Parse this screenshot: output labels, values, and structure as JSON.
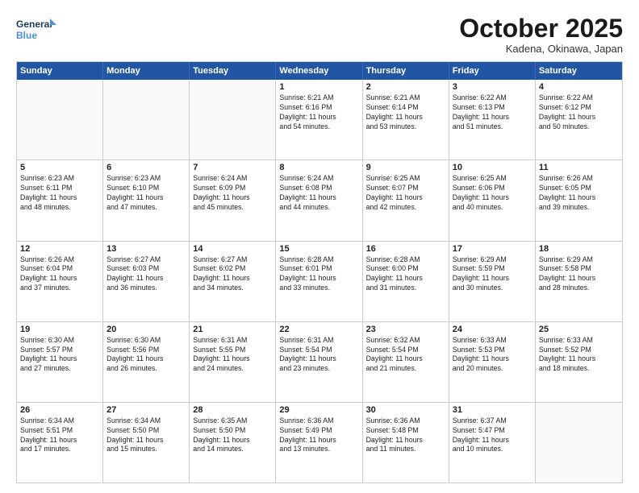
{
  "header": {
    "logo_line1": "General",
    "logo_line2": "Blue",
    "month": "October 2025",
    "location": "Kadena, Okinawa, Japan"
  },
  "weekdays": [
    "Sunday",
    "Monday",
    "Tuesday",
    "Wednesday",
    "Thursday",
    "Friday",
    "Saturday"
  ],
  "weeks": [
    [
      {
        "day": "",
        "info": ""
      },
      {
        "day": "",
        "info": ""
      },
      {
        "day": "",
        "info": ""
      },
      {
        "day": "1",
        "info": "Sunrise: 6:21 AM\nSunset: 6:16 PM\nDaylight: 11 hours\nand 54 minutes."
      },
      {
        "day": "2",
        "info": "Sunrise: 6:21 AM\nSunset: 6:14 PM\nDaylight: 11 hours\nand 53 minutes."
      },
      {
        "day": "3",
        "info": "Sunrise: 6:22 AM\nSunset: 6:13 PM\nDaylight: 11 hours\nand 51 minutes."
      },
      {
        "day": "4",
        "info": "Sunrise: 6:22 AM\nSunset: 6:12 PM\nDaylight: 11 hours\nand 50 minutes."
      }
    ],
    [
      {
        "day": "5",
        "info": "Sunrise: 6:23 AM\nSunset: 6:11 PM\nDaylight: 11 hours\nand 48 minutes."
      },
      {
        "day": "6",
        "info": "Sunrise: 6:23 AM\nSunset: 6:10 PM\nDaylight: 11 hours\nand 47 minutes."
      },
      {
        "day": "7",
        "info": "Sunrise: 6:24 AM\nSunset: 6:09 PM\nDaylight: 11 hours\nand 45 minutes."
      },
      {
        "day": "8",
        "info": "Sunrise: 6:24 AM\nSunset: 6:08 PM\nDaylight: 11 hours\nand 44 minutes."
      },
      {
        "day": "9",
        "info": "Sunrise: 6:25 AM\nSunset: 6:07 PM\nDaylight: 11 hours\nand 42 minutes."
      },
      {
        "day": "10",
        "info": "Sunrise: 6:25 AM\nSunset: 6:06 PM\nDaylight: 11 hours\nand 40 minutes."
      },
      {
        "day": "11",
        "info": "Sunrise: 6:26 AM\nSunset: 6:05 PM\nDaylight: 11 hours\nand 39 minutes."
      }
    ],
    [
      {
        "day": "12",
        "info": "Sunrise: 6:26 AM\nSunset: 6:04 PM\nDaylight: 11 hours\nand 37 minutes."
      },
      {
        "day": "13",
        "info": "Sunrise: 6:27 AM\nSunset: 6:03 PM\nDaylight: 11 hours\nand 36 minutes."
      },
      {
        "day": "14",
        "info": "Sunrise: 6:27 AM\nSunset: 6:02 PM\nDaylight: 11 hours\nand 34 minutes."
      },
      {
        "day": "15",
        "info": "Sunrise: 6:28 AM\nSunset: 6:01 PM\nDaylight: 11 hours\nand 33 minutes."
      },
      {
        "day": "16",
        "info": "Sunrise: 6:28 AM\nSunset: 6:00 PM\nDaylight: 11 hours\nand 31 minutes."
      },
      {
        "day": "17",
        "info": "Sunrise: 6:29 AM\nSunset: 5:59 PM\nDaylight: 11 hours\nand 30 minutes."
      },
      {
        "day": "18",
        "info": "Sunrise: 6:29 AM\nSunset: 5:58 PM\nDaylight: 11 hours\nand 28 minutes."
      }
    ],
    [
      {
        "day": "19",
        "info": "Sunrise: 6:30 AM\nSunset: 5:57 PM\nDaylight: 11 hours\nand 27 minutes."
      },
      {
        "day": "20",
        "info": "Sunrise: 6:30 AM\nSunset: 5:56 PM\nDaylight: 11 hours\nand 26 minutes."
      },
      {
        "day": "21",
        "info": "Sunrise: 6:31 AM\nSunset: 5:55 PM\nDaylight: 11 hours\nand 24 minutes."
      },
      {
        "day": "22",
        "info": "Sunrise: 6:31 AM\nSunset: 5:54 PM\nDaylight: 11 hours\nand 23 minutes."
      },
      {
        "day": "23",
        "info": "Sunrise: 6:32 AM\nSunset: 5:54 PM\nDaylight: 11 hours\nand 21 minutes."
      },
      {
        "day": "24",
        "info": "Sunrise: 6:33 AM\nSunset: 5:53 PM\nDaylight: 11 hours\nand 20 minutes."
      },
      {
        "day": "25",
        "info": "Sunrise: 6:33 AM\nSunset: 5:52 PM\nDaylight: 11 hours\nand 18 minutes."
      }
    ],
    [
      {
        "day": "26",
        "info": "Sunrise: 6:34 AM\nSunset: 5:51 PM\nDaylight: 11 hours\nand 17 minutes."
      },
      {
        "day": "27",
        "info": "Sunrise: 6:34 AM\nSunset: 5:50 PM\nDaylight: 11 hours\nand 15 minutes."
      },
      {
        "day": "28",
        "info": "Sunrise: 6:35 AM\nSunset: 5:50 PM\nDaylight: 11 hours\nand 14 minutes."
      },
      {
        "day": "29",
        "info": "Sunrise: 6:36 AM\nSunset: 5:49 PM\nDaylight: 11 hours\nand 13 minutes."
      },
      {
        "day": "30",
        "info": "Sunrise: 6:36 AM\nSunset: 5:48 PM\nDaylight: 11 hours\nand 11 minutes."
      },
      {
        "day": "31",
        "info": "Sunrise: 6:37 AM\nSunset: 5:47 PM\nDaylight: 11 hours\nand 10 minutes."
      },
      {
        "day": "",
        "info": ""
      }
    ]
  ]
}
